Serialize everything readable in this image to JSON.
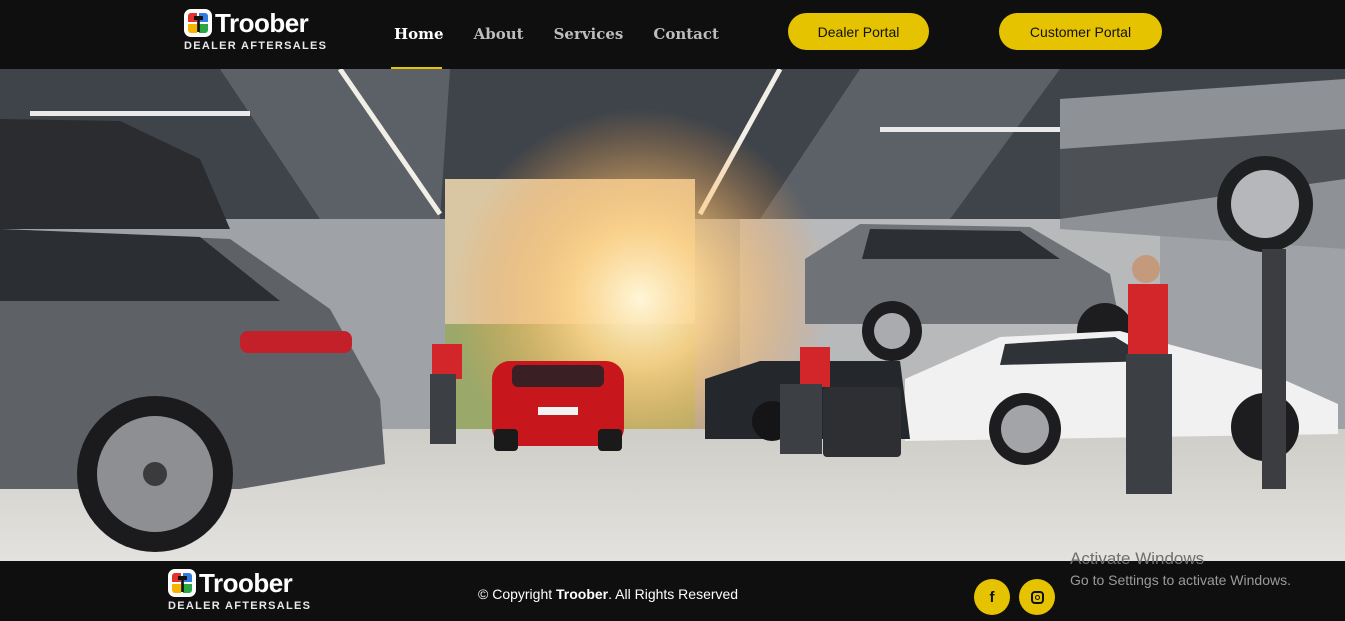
{
  "header": {
    "logo": {
      "name": "Troober",
      "tagline": "DEALER AFTERSALES"
    },
    "nav": [
      {
        "label": "Home",
        "active": true
      },
      {
        "label": "About",
        "active": false
      },
      {
        "label": "Services",
        "active": false
      },
      {
        "label": "Contact",
        "active": false
      }
    ],
    "dealer_portal_label": "Dealer Portal",
    "customer_portal_label": "Customer Portal"
  },
  "hero": {
    "image": "car-service-workshop-photo"
  },
  "footer": {
    "logo": {
      "name": "Troober",
      "tagline": "DEALER AFTERSALES"
    },
    "copyright_prefix": "© Copyright ",
    "copyright_brand": "Troober",
    "copyright_suffix": ". All Rights Reserved",
    "social": [
      {
        "icon": "facebook-icon",
        "glyph": "f"
      },
      {
        "icon": "instagram-icon"
      }
    ]
  },
  "watermark": {
    "title": "Activate Windows",
    "subtitle": "Go to Settings to activate Windows."
  },
  "colors": {
    "accent": "#e5c300",
    "header_bg": "#0f0f0f"
  }
}
